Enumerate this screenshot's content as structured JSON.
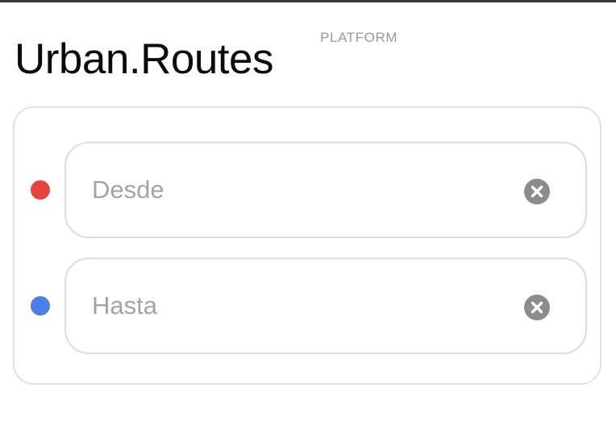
{
  "header": {
    "brand_primary": "Urban.",
    "brand_secondary": "Routes",
    "platform_label": "PLATFORM"
  },
  "route_form": {
    "from": {
      "placeholder": "Desde",
      "value": "",
      "marker_color": "#e8443f",
      "clear_icon": "clear-circle-icon"
    },
    "to": {
      "placeholder": "Hasta",
      "value": "",
      "marker_color": "#4a7fe6",
      "clear_icon": "clear-circle-icon"
    }
  },
  "colors": {
    "text": "#0b0b0b",
    "muted": "#9a9a9a",
    "border": "#dcdcdc",
    "clear_button": "#8c8c8c"
  }
}
